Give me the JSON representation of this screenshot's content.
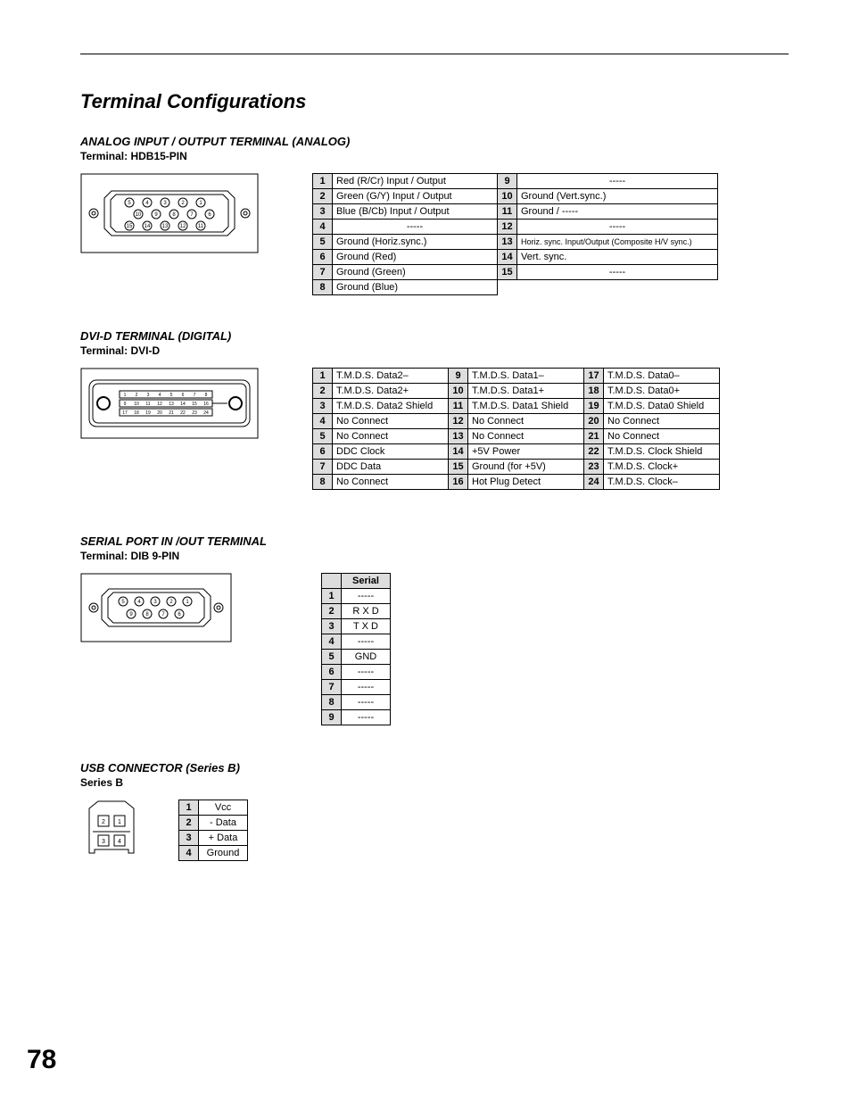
{
  "page_number": "78",
  "title": "Terminal Configurations",
  "analog": {
    "heading": "ANALOG INPUT / OUTPUT TERMINAL (ANALOG)",
    "sub": "Terminal: HDB15-PIN",
    "rows_left": [
      {
        "n": "1",
        "v": "Red (R/Cr) Input / Output"
      },
      {
        "n": "2",
        "v": "Green (G/Y) Input / Output"
      },
      {
        "n": "3",
        "v": "Blue (B/Cb) Input / Output"
      },
      {
        "n": "4",
        "v": "-----"
      },
      {
        "n": "5",
        "v": "Ground (Horiz.sync.)"
      },
      {
        "n": "6",
        "v": "Ground (Red)"
      },
      {
        "n": "7",
        "v": "Ground (Green)"
      },
      {
        "n": "8",
        "v": "Ground (Blue)"
      }
    ],
    "rows_right": [
      {
        "n": "9",
        "v": "-----"
      },
      {
        "n": "10",
        "v": "Ground (Vert.sync.)"
      },
      {
        "n": "11",
        "v": "Ground /  -----"
      },
      {
        "n": "12",
        "v": "-----"
      },
      {
        "n": "13",
        "v": "Horiz. sync. Input/Output (Composite H/V sync.)"
      },
      {
        "n": "14",
        "v": "Vert. sync."
      },
      {
        "n": "15",
        "v": "-----"
      }
    ]
  },
  "dvi": {
    "heading": "DVI-D TERMINAL (DIGITAL)",
    "sub": "Terminal: DVI-D",
    "col1": [
      {
        "n": "1",
        "v": "T.M.D.S. Data2–"
      },
      {
        "n": "2",
        "v": "T.M.D.S. Data2+"
      },
      {
        "n": "3",
        "v": "T.M.D.S. Data2 Shield"
      },
      {
        "n": "4",
        "v": "No Connect"
      },
      {
        "n": "5",
        "v": "No Connect"
      },
      {
        "n": "6",
        "v": "DDC Clock"
      },
      {
        "n": "7",
        "v": "DDC Data"
      },
      {
        "n": "8",
        "v": "No Connect"
      }
    ],
    "col2": [
      {
        "n": "9",
        "v": "T.M.D.S. Data1–"
      },
      {
        "n": "10",
        "v": "T.M.D.S. Data1+"
      },
      {
        "n": "11",
        "v": "T.M.D.S. Data1 Shield"
      },
      {
        "n": "12",
        "v": "No Connect"
      },
      {
        "n": "13",
        "v": "No Connect"
      },
      {
        "n": "14",
        "v": "+5V Power"
      },
      {
        "n": "15",
        "v": "Ground (for +5V)"
      },
      {
        "n": "16",
        "v": "Hot Plug Detect"
      }
    ],
    "col3": [
      {
        "n": "17",
        "v": "T.M.D.S. Data0–"
      },
      {
        "n": "18",
        "v": "T.M.D.S. Data0+"
      },
      {
        "n": "19",
        "v": "T.M.D.S. Data0 Shield"
      },
      {
        "n": "20",
        "v": "No Connect"
      },
      {
        "n": "21",
        "v": "No Connect"
      },
      {
        "n": "22",
        "v": "T.M.D.S. Clock Shield"
      },
      {
        "n": "23",
        "v": "T.M.D.S. Clock+"
      },
      {
        "n": "24",
        "v": "T.M.D.S. Clock–"
      }
    ]
  },
  "serial": {
    "heading": "SERIAL PORT IN /OUT TERMINAL",
    "sub": "Terminal: DIB 9-PIN",
    "header": "Serial",
    "rows": [
      {
        "n": "1",
        "v": "-----"
      },
      {
        "n": "2",
        "v": "R X D"
      },
      {
        "n": "3",
        "v": "T X D"
      },
      {
        "n": "4",
        "v": "-----"
      },
      {
        "n": "5",
        "v": "GND"
      },
      {
        "n": "6",
        "v": "-----"
      },
      {
        "n": "7",
        "v": "-----"
      },
      {
        "n": "8",
        "v": "-----"
      },
      {
        "n": "9",
        "v": "-----"
      }
    ]
  },
  "usb": {
    "heading": "USB CONNECTOR (Series B)",
    "sub": "Series B",
    "rows": [
      {
        "n": "1",
        "v": "Vcc"
      },
      {
        "n": "2",
        "v": "- Data"
      },
      {
        "n": "3",
        "v": "+ Data"
      },
      {
        "n": "4",
        "v": "Ground"
      }
    ]
  }
}
